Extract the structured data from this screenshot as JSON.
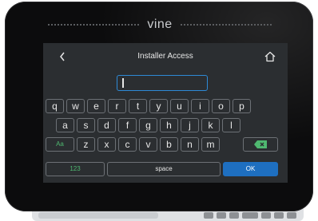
{
  "brand": {
    "name": "vine"
  },
  "header": {
    "title": "Installer Access",
    "back_icon": "chevron-left-icon",
    "home_icon": "home-icon"
  },
  "input": {
    "value": ""
  },
  "keyboard": {
    "row1": [
      "q",
      "w",
      "e",
      "r",
      "t",
      "y",
      "u",
      "i",
      "o",
      "p"
    ],
    "row2": [
      "a",
      "s",
      "d",
      "f",
      "g",
      "h",
      "j",
      "k",
      "l"
    ],
    "row3": [
      "z",
      "x",
      "c",
      "v",
      "b",
      "n",
      "m"
    ],
    "case_key": "Aa",
    "numbers_key": "123",
    "space_key": "space",
    "ok_key": "OK",
    "delete_icon": "backspace-icon"
  },
  "colors": {
    "accent_blue": "#1e6fc0",
    "accent_green": "#4fb870",
    "screen_bg": "#2b2e31",
    "bezel": "#0c0c0d"
  }
}
